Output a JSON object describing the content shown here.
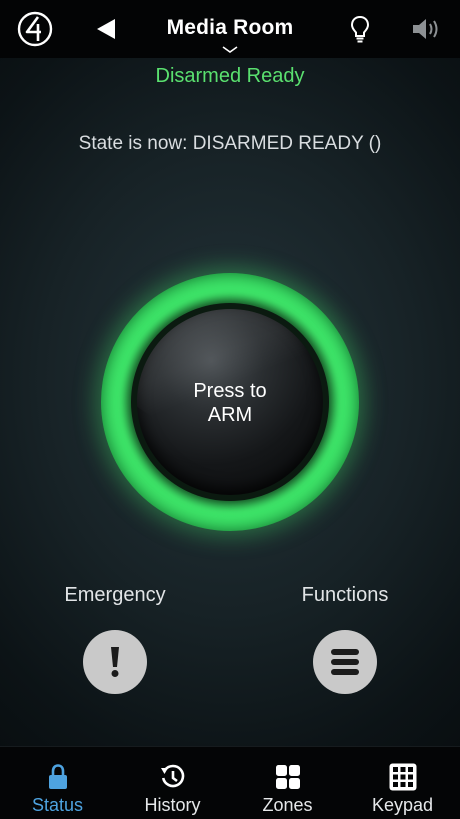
{
  "header": {
    "title": "Media Room",
    "icons": {
      "logo": "control4-logo-icon",
      "back": "back-arrow-icon",
      "room_menu": "chevron-down-icon",
      "lights": "lightbulb-icon",
      "volume": "speaker-volume-icon"
    }
  },
  "status": {
    "headline": "Disarmed Ready",
    "state_message": "State is now: DISARMED READY ()"
  },
  "arm_button": {
    "line1": "Press to",
    "line2": "ARM"
  },
  "actions": {
    "emergency_label": "Emergency",
    "functions_label": "Functions",
    "emergency_icon": "exclamation-icon",
    "functions_icon": "menu-lines-icon"
  },
  "tabs": [
    {
      "label": "Status",
      "icon": "lock-icon",
      "active": true
    },
    {
      "label": "History",
      "icon": "history-clock-icon",
      "active": false
    },
    {
      "label": "Zones",
      "icon": "zones-grid-icon",
      "active": false
    },
    {
      "label": "Keypad",
      "icon": "keypad-grid-icon",
      "active": false
    }
  ],
  "colors": {
    "accent_green": "#5ae06f",
    "ring_green": "#3fe86a",
    "active_tab_blue": "#4ea3e0",
    "button_gray": "#c9c9c9"
  }
}
